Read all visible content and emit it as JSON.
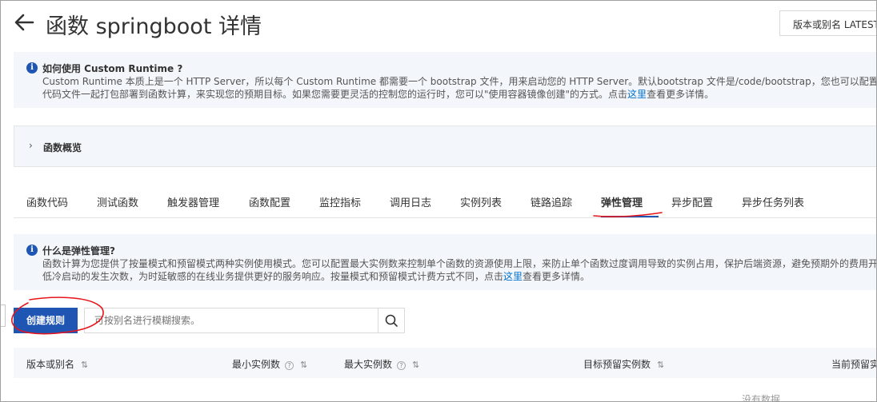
{
  "header": {
    "title": "函数 springboot 详情",
    "version_select": "版本或别名   LATEST"
  },
  "notice_runtime": {
    "title": "如何使用 Custom Runtime ?",
    "line1": "Custom Runtime 本质上是一个 HTTP Server，所以每个 Custom Runtime 都需要一个 bootstrap 文件，用来启动您的 HTTP Server。默认bootstrap 文件是/code/bootstrap，您也可以配置自定义的启动",
    "line2_before": "代码文件一起打包部署到函数计算，来实现您的预期目标。如果您需要更灵活的控制您的运行时，您可以\"使用容器镜像创建\"的方式。点击",
    "line2_link": "这里",
    "line2_after": "查看更多详情。"
  },
  "overview": {
    "label": "函数概览"
  },
  "tabs": [
    {
      "label": "函数代码"
    },
    {
      "label": "测试函数"
    },
    {
      "label": "触发器管理"
    },
    {
      "label": "函数配置"
    },
    {
      "label": "监控指标"
    },
    {
      "label": "调用日志"
    },
    {
      "label": "实例列表"
    },
    {
      "label": "链路追踪"
    },
    {
      "label": "弹性管理"
    },
    {
      "label": "异步配置"
    },
    {
      "label": "异步任务列表"
    }
  ],
  "notice_elastic": {
    "title": "什么是弹性管理?",
    "line1": "函数计算为您提供了按量模式和预留模式两种实例使用模式。您可以配置最大实例数来控制单个函数的资源使用上限，来防止单个函数过度调用导致的实例占用，保护后端资源，避免预期外的费用开",
    "line2_before": "低冷启动的发生次数，为时延敏感的在线业务提供更好的服务响应。按量模式和预留模式计费方式不同，点击",
    "line2_link": "这里",
    "line2_after": "查看更多详情。"
  },
  "toolbar": {
    "create_label": "创建规则",
    "search_placeholder": "可按别名进行模糊搜索。"
  },
  "table": {
    "columns": [
      {
        "label": "版本或别名"
      },
      {
        "label": "最小实例数"
      },
      {
        "label": "最大实例数"
      },
      {
        "label": "目标预留实例数"
      },
      {
        "label": "当前预留实"
      }
    ],
    "empty_text": "没有数据"
  },
  "colors": {
    "primary": "#1f56b4",
    "annotation": "#e8141b",
    "info_bg": "#f3f6fa"
  }
}
